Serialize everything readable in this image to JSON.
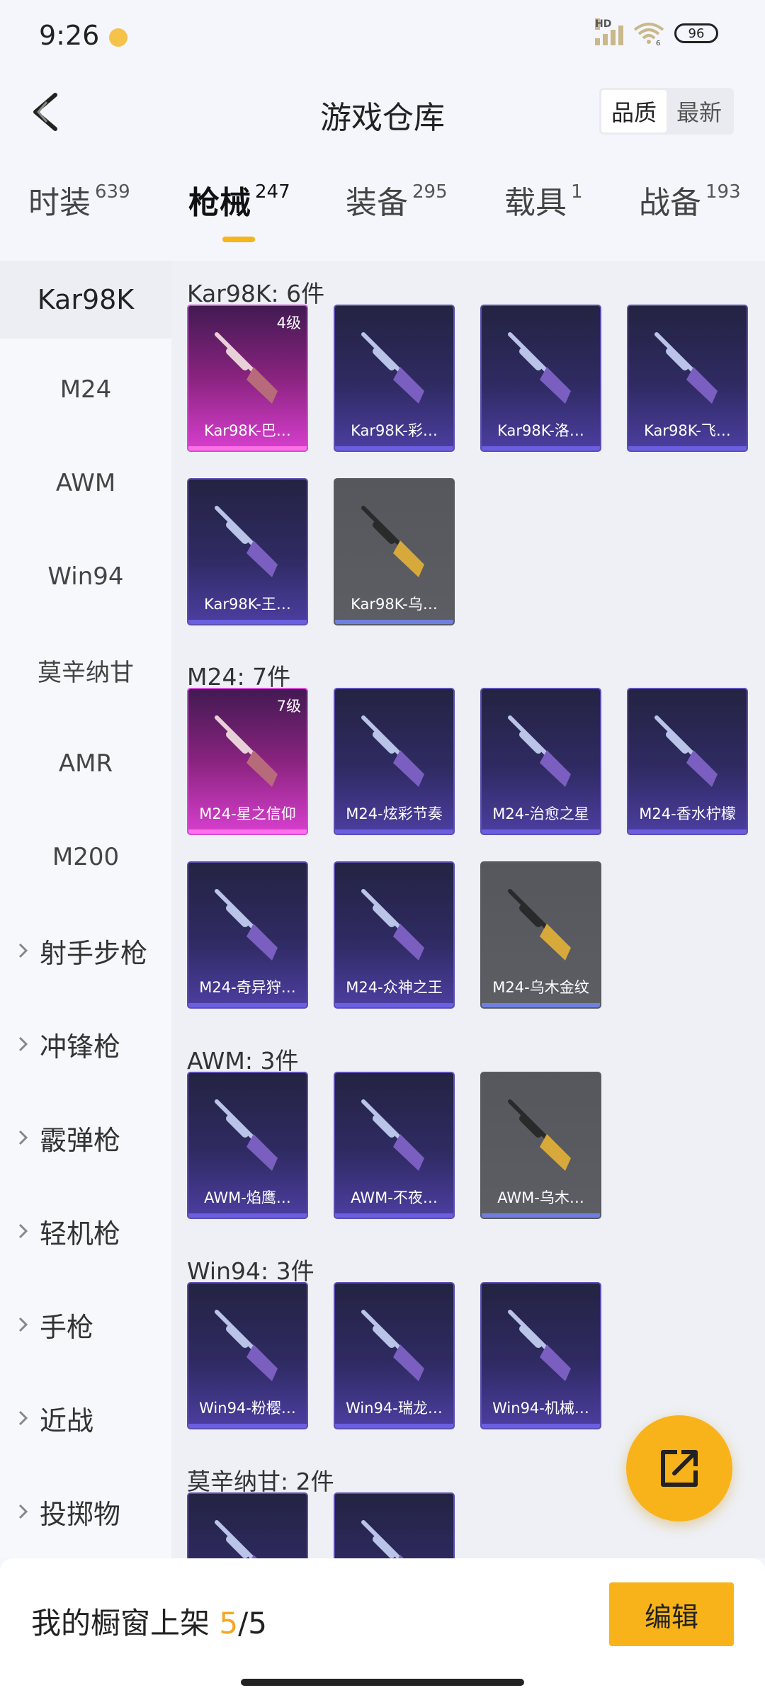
{
  "status_bar": {
    "time": "9:26",
    "hd": "HD",
    "wifi_sub": "6",
    "battery": "96"
  },
  "header": {
    "title": "游戏仓库",
    "sort_options": [
      {
        "label": "品质"
      },
      {
        "label": "最新"
      }
    ]
  },
  "category_tabs": [
    {
      "label": "时装",
      "count": "639"
    },
    {
      "label": "枪械",
      "count": "247"
    },
    {
      "label": "装备",
      "count": "295"
    },
    {
      "label": "载具",
      "count": "1"
    },
    {
      "label": "战备",
      "count": "193"
    }
  ],
  "sidebar": {
    "items": [
      "Kar98K",
      "M24",
      "AWM",
      "Win94",
      "莫辛纳甘",
      "AMR",
      "M200"
    ],
    "groups": [
      "射手步枪",
      "冲锋枪",
      "霰弹枪",
      "轻机枪",
      "手枪",
      "近战",
      "投掷物"
    ]
  },
  "sections": [
    {
      "title": "Kar98K: 6件",
      "items": [
        {
          "name": "Kar98K-巴…",
          "level": "4级",
          "rarity": "pink"
        },
        {
          "name": "Kar98K-彩…",
          "rarity": "purple"
        },
        {
          "name": "Kar98K-洛…",
          "rarity": "purple"
        },
        {
          "name": "Kar98K-飞…",
          "rarity": "purple"
        },
        {
          "name": "Kar98K-王…",
          "rarity": "purple"
        },
        {
          "name": "Kar98K-乌…",
          "rarity": "gray"
        }
      ]
    },
    {
      "title": "M24: 7件",
      "items": [
        {
          "name": "M24-星之信仰",
          "level": "7级",
          "rarity": "pink"
        },
        {
          "name": "M24-炫彩节奏",
          "rarity": "purple"
        },
        {
          "name": "M24-治愈之星",
          "rarity": "purple"
        },
        {
          "name": "M24-香水柠檬",
          "rarity": "purple"
        },
        {
          "name": "M24-奇异狩…",
          "rarity": "purple"
        },
        {
          "name": "M24-众神之王",
          "rarity": "purple"
        },
        {
          "name": "M24-乌木金纹",
          "rarity": "gray"
        }
      ]
    },
    {
      "title": "AWM: 3件",
      "items": [
        {
          "name": "AWM-焰鹰…",
          "rarity": "purple"
        },
        {
          "name": "AWM-不夜…",
          "rarity": "purple"
        },
        {
          "name": "AWM-乌木…",
          "rarity": "gray"
        }
      ]
    },
    {
      "title": "Win94: 3件",
      "items": [
        {
          "name": "Win94-粉樱…",
          "rarity": "purple"
        },
        {
          "name": "Win94-瑞龙…",
          "rarity": "purple"
        },
        {
          "name": "Win94-机械…",
          "rarity": "purple"
        }
      ]
    },
    {
      "title": "莫辛纳甘: 2件",
      "items": [
        {
          "name": "",
          "rarity": "purple"
        },
        {
          "name": "",
          "rarity": "purple"
        }
      ]
    }
  ],
  "bottom": {
    "showcase_label": "我的橱窗上架",
    "current": "5",
    "total": "/5",
    "edit_label": "编辑"
  },
  "colors": {
    "accent": "#f8b31a",
    "rare_purple": "#5c4fb2",
    "rare_pink": "#d44cd4",
    "common_gray": "#585b62"
  }
}
